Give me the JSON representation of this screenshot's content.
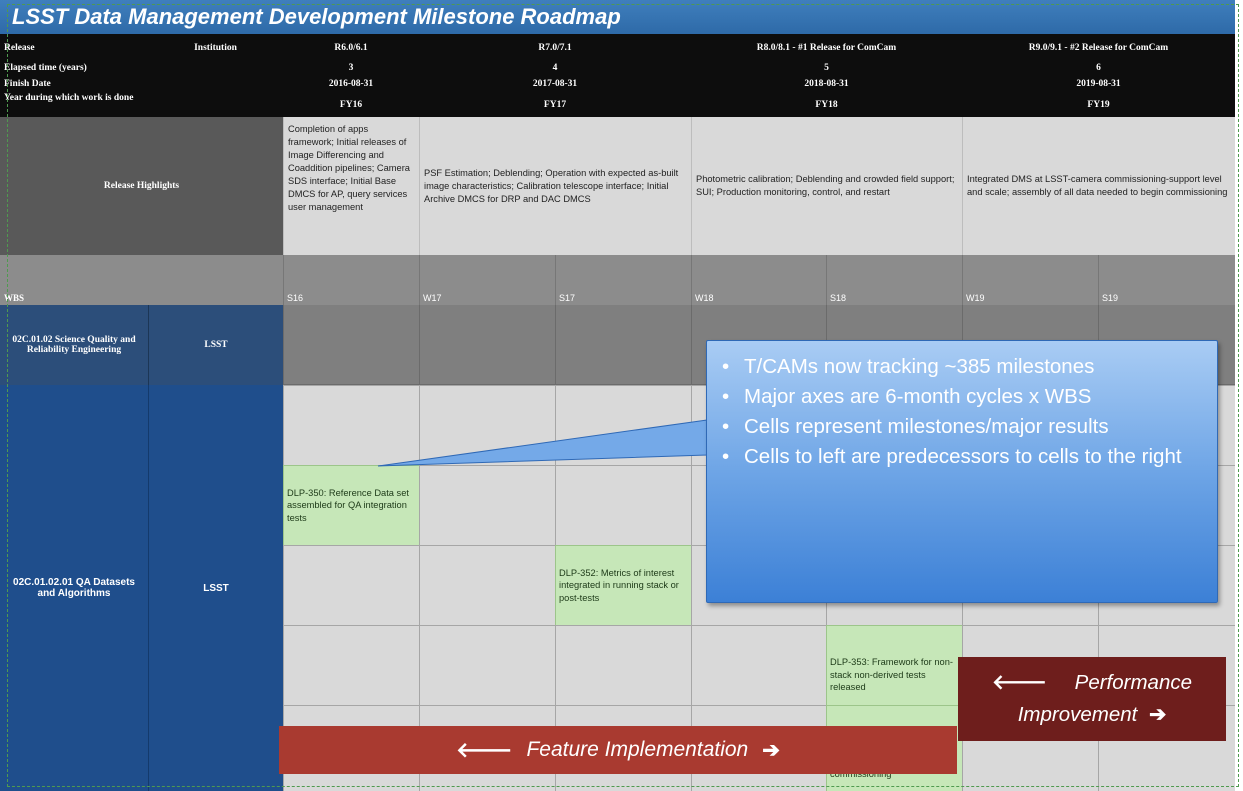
{
  "title": "LSST Data Management Development Milestone Roadmap",
  "header": {
    "release_label": "Release",
    "institution_label": "Institution",
    "elapsed_label": "Elapsed time (years)",
    "finish_label": "Finish Date",
    "year_label": "Year during which work is done",
    "releases": [
      {
        "name": "R6.0/6.1",
        "elapsed": "3",
        "finish": "2016-08-31",
        "fy": "FY16"
      },
      {
        "name": "R7.0/7.1",
        "elapsed": "4",
        "finish": "2017-08-31",
        "fy": "FY17"
      },
      {
        "name": "R8.0/8.1 - #1 Release for ComCam",
        "elapsed": "5",
        "finish": "2018-08-31",
        "fy": "FY18"
      },
      {
        "name": "R9.0/9.1 - #2 Release for ComCam",
        "elapsed": "6",
        "finish": "2019-08-31",
        "fy": "FY19"
      }
    ]
  },
  "highlights": {
    "label": "Release Highlights",
    "items": [
      "Completion of apps framework; Initial releases of Image Differencing and Coaddition pipelines; Camera SDS interface; Initial Base DMCS for AP, query services user management",
      "PSF Estimation; Deblending; Operation with expected as-built image characteristics; Calibration telescope interface; Initial Archive DMCS for DRP and DAC DMCS",
      "Photometric calibration; Deblending and crowded field support; SUI; Production monitoring, control, and restart",
      "Integrated DMS at LSST-camera commissioning-support level and scale; assembly of all data needed to begin commissioning"
    ]
  },
  "wbs": {
    "label": "WBS",
    "cycles": [
      "S16",
      "W17",
      "S17",
      "W18",
      "S18",
      "W19",
      "S19"
    ]
  },
  "rows": {
    "sq_label": "02C.01.02 Science Quality and Reliability Engineering",
    "sq_institution": "LSST",
    "qa_label": "02C.01.02.01 QA Datasets and Algorithms",
    "qa_institution": "LSST"
  },
  "milestones": [
    "DLP-350: Reference Data set assembled for QA integration tests",
    "DLP-352: Metrics of interest integrated in running stack or post-tests",
    "DLP-353: Framework for non-stack non-derived tests released",
    "commissioning"
  ],
  "callout": {
    "bullets": [
      "T/CAMs now tracking ~385 milestones",
      "Major axes are 6-month cycles x WBS",
      "Cells represent milestones/major results",
      "Cells to left are predecessors to cells to the right"
    ]
  },
  "feature_label": "Feature Implementation",
  "performance_label_1": "Performance",
  "performance_label_2": "Improvement",
  "arrows": {
    "left": "🡐",
    "right": "➔"
  },
  "colors": {
    "title_bar": "#3573b5",
    "header_bg": "#0d0d0d",
    "wbs_row": "#8c8c8c",
    "row_blue": "#1f4e8c",
    "milestone_green": "#c6e7b8",
    "callout_blue": "#5c98e2",
    "feature_red": "#a93a30",
    "performance_maroon": "#6e1e1c"
  }
}
